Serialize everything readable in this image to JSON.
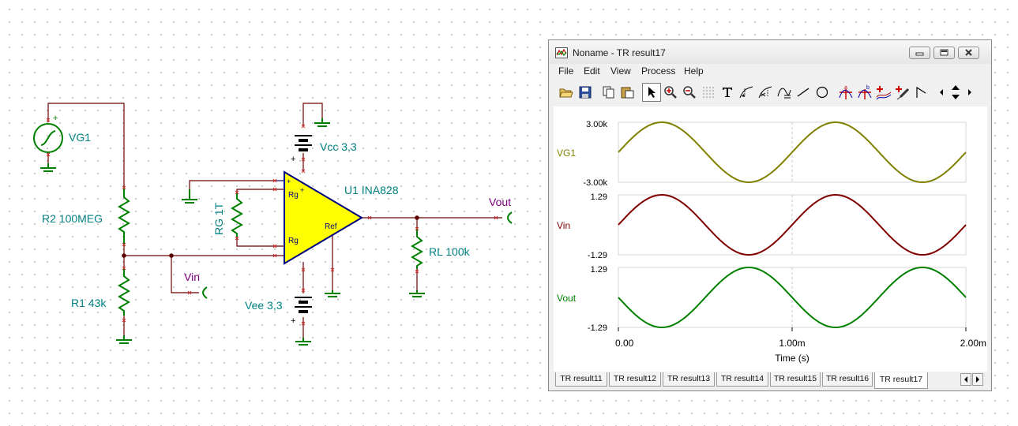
{
  "schematic": {
    "vg1_label": "VG1",
    "r2_label": "R2 100MEG",
    "r1_label": "R1 43k",
    "rg_label": "RG 1T",
    "vcc_label": "Vcc 3,3",
    "vee_label": "Vee 3,3",
    "u1_label": "U1 INA828",
    "rl_label": "RL 100k",
    "vin_label": "Vin",
    "vout_label": "Vout",
    "pin_rg_top": "Rg",
    "pin_rg_bottom": "Rg",
    "pin_ref": "Ref",
    "plus_sign": "+",
    "colors": {
      "wire": "#6b0000",
      "component": "#008000",
      "label": "#008080",
      "probe_label": "#800080",
      "opamp_fill": "#ffff00",
      "opamp_border": "#000080"
    }
  },
  "window": {
    "title": "Noname - TR result17",
    "menu": [
      "File",
      "Edit",
      "View",
      "Process",
      "Help"
    ],
    "toolbar_icons": [
      "open-icon",
      "save-icon",
      "copy-icon",
      "paste-icon",
      "pointer-icon",
      "zoom-in-icon",
      "zoom-out-icon",
      "grid-icon",
      "text-icon",
      "cursor-a-icon",
      "cursor-b-icon",
      "curve-icon",
      "line-icon",
      "circle-icon",
      "marker-a-icon",
      "marker-b-icon",
      "marker-c-icon",
      "probe-icon",
      "flag-icon",
      "left-icon",
      "up-down-icon",
      "right-icon"
    ],
    "tabs": [
      "TR result11",
      "TR result12",
      "TR result13",
      "TR result14",
      "TR result15",
      "TR result16",
      "TR result17"
    ],
    "active_tab": "TR result17"
  },
  "chart_data": [
    {
      "type": "line",
      "series": [
        {
          "name": "VG1",
          "color": "#808000",
          "amplitude": 3.0,
          "phase_deg": 0,
          "period": 0.001
        }
      ],
      "x_range": [
        0,
        0.002
      ],
      "ylim": [
        -3.0,
        3.0
      ],
      "y_ticks": [
        "3.00k",
        "-3.00k"
      ]
    },
    {
      "type": "line",
      "series": [
        {
          "name": "Vin",
          "color": "#800000",
          "amplitude": 1.29,
          "phase_deg": 0,
          "period": 0.001
        }
      ],
      "x_range": [
        0,
        0.002
      ],
      "ylim": [
        -1.29,
        1.29
      ],
      "y_ticks": [
        "1.29",
        "-1.29"
      ]
    },
    {
      "type": "line",
      "series": [
        {
          "name": "Vout",
          "color": "#008000",
          "amplitude": 1.29,
          "phase_deg": 180,
          "period": 0.001
        }
      ],
      "x_range": [
        0,
        0.002
      ],
      "ylim": [
        -1.29,
        1.29
      ],
      "y_ticks": [
        "1.29",
        "-1.29"
      ],
      "x_ticks": [
        "0.00",
        "1.00m",
        "2.00m"
      ],
      "xlabel": "Time (s)",
      "grid": "vertical-dashed-at-midpoint"
    }
  ]
}
